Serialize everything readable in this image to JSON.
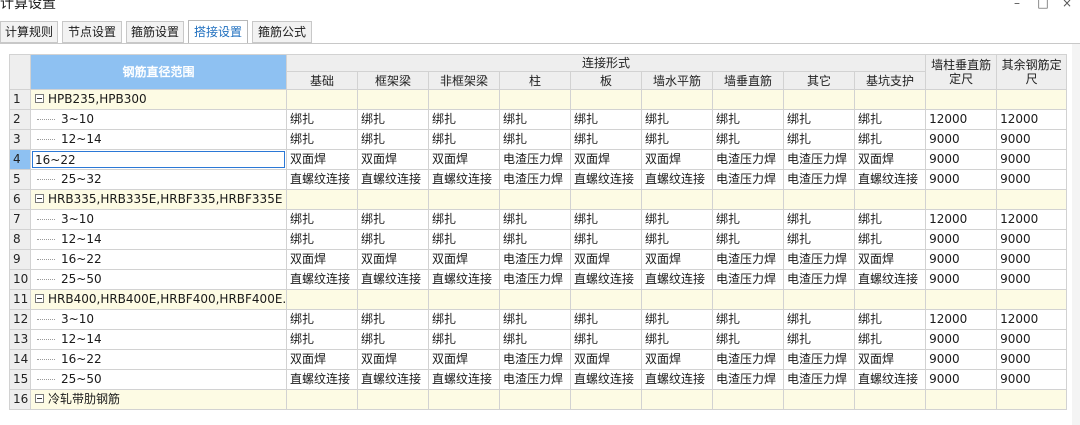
{
  "window": {
    "title": "计算设置",
    "controls": {
      "minimize": "–",
      "maximize": "□",
      "close": "×"
    }
  },
  "tabs": [
    {
      "label": "计算规则",
      "active": false
    },
    {
      "label": "节点设置",
      "active": false
    },
    {
      "label": "箍筋设置",
      "active": false
    },
    {
      "label": "搭接设置",
      "active": true
    },
    {
      "label": "箍筋公式",
      "active": false
    }
  ],
  "grid": {
    "range_header": "钢筋直径范围",
    "group_header": "连接形式",
    "columns": [
      "基础",
      "框架梁",
      "非框架梁",
      "柱",
      "板",
      "墙水平筋",
      "墙垂直筋",
      "其它",
      "基坑支护"
    ],
    "tail_headers": [
      "墙柱垂直筋定尺",
      "其余钢筋定尺"
    ],
    "selected_row": 4,
    "rows": [
      {
        "num": "1",
        "group": true,
        "label": "HPB235,HPB300"
      },
      {
        "num": "2",
        "label": "3~10",
        "cells": [
          "绑扎",
          "绑扎",
          "绑扎",
          "绑扎",
          "绑扎",
          "绑扎",
          "绑扎",
          "绑扎",
          "绑扎",
          "12000",
          "12000"
        ]
      },
      {
        "num": "3",
        "label": "12~14",
        "cells": [
          "绑扎",
          "绑扎",
          "绑扎",
          "绑扎",
          "绑扎",
          "绑扎",
          "绑扎",
          "绑扎",
          "绑扎",
          "9000",
          "9000"
        ]
      },
      {
        "num": "4",
        "label": "16~22",
        "editing": true,
        "cells": [
          "双面焊",
          "双面焊",
          "双面焊",
          "电渣压力焊",
          "双面焊",
          "双面焊",
          "电渣压力焊",
          "电渣压力焊",
          "双面焊",
          "9000",
          "9000"
        ]
      },
      {
        "num": "5",
        "label": "25~32",
        "cells": [
          "直螺纹连接",
          "直螺纹连接",
          "直螺纹连接",
          "电渣压力焊",
          "直螺纹连接",
          "直螺纹连接",
          "电渣压力焊",
          "电渣压力焊",
          "直螺纹连接",
          "9000",
          "9000"
        ]
      },
      {
        "num": "6",
        "group": true,
        "label": "HRB335,HRB335E,HRBF335,HRBF335E"
      },
      {
        "num": "7",
        "label": "3~10",
        "cells": [
          "绑扎",
          "绑扎",
          "绑扎",
          "绑扎",
          "绑扎",
          "绑扎",
          "绑扎",
          "绑扎",
          "绑扎",
          "12000",
          "12000"
        ]
      },
      {
        "num": "8",
        "label": "12~14",
        "cells": [
          "绑扎",
          "绑扎",
          "绑扎",
          "绑扎",
          "绑扎",
          "绑扎",
          "绑扎",
          "绑扎",
          "绑扎",
          "9000",
          "9000"
        ]
      },
      {
        "num": "9",
        "label": "16~22",
        "cells": [
          "双面焊",
          "双面焊",
          "双面焊",
          "电渣压力焊",
          "双面焊",
          "双面焊",
          "电渣压力焊",
          "电渣压力焊",
          "双面焊",
          "9000",
          "9000"
        ]
      },
      {
        "num": "10",
        "label": "25~50",
        "cells": [
          "直螺纹连接",
          "直螺纹连接",
          "直螺纹连接",
          "电渣压力焊",
          "直螺纹连接",
          "直螺纹连接",
          "电渣压力焊",
          "电渣压力焊",
          "直螺纹连接",
          "9000",
          "9000"
        ]
      },
      {
        "num": "11",
        "group": true,
        "label": "HRB400,HRB400E,HRBF400,HRBF400E..."
      },
      {
        "num": "12",
        "label": "3~10",
        "cells": [
          "绑扎",
          "绑扎",
          "绑扎",
          "绑扎",
          "绑扎",
          "绑扎",
          "绑扎",
          "绑扎",
          "绑扎",
          "12000",
          "12000"
        ]
      },
      {
        "num": "13",
        "label": "12~14",
        "cells": [
          "绑扎",
          "绑扎",
          "绑扎",
          "绑扎",
          "绑扎",
          "绑扎",
          "绑扎",
          "绑扎",
          "绑扎",
          "9000",
          "9000"
        ]
      },
      {
        "num": "14",
        "label": "16~22",
        "cells": [
          "双面焊",
          "双面焊",
          "双面焊",
          "电渣压力焊",
          "双面焊",
          "双面焊",
          "电渣压力焊",
          "电渣压力焊",
          "双面焊",
          "9000",
          "9000"
        ]
      },
      {
        "num": "15",
        "label": "25~50",
        "cells": [
          "直螺纹连接",
          "直螺纹连接",
          "直螺纹连接",
          "电渣压力焊",
          "直螺纹连接",
          "直螺纹连接",
          "电渣压力焊",
          "电渣压力焊",
          "直螺纹连接",
          "9000",
          "9000"
        ]
      },
      {
        "num": "16",
        "group": true,
        "label": "冷轧带肋钢筋"
      }
    ]
  }
}
